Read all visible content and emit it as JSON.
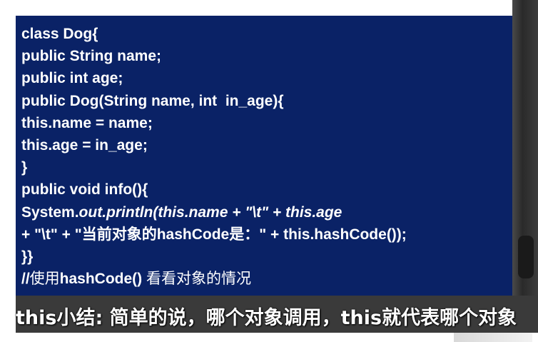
{
  "code": {
    "lines": [
      "class Dog{",
      "public String name;",
      "public int age;",
      "public Dog(String name, int  in_age){",
      "this.name = name;",
      "this.age = in_age;",
      "}",
      "public void info(){"
    ],
    "println": {
      "prefix": "System.",
      "out": "out",
      "dot": ".",
      "method": "println(",
      "this_name": "this.name",
      "plus_tab": " + \"\\t\" + ",
      "this_age": "this.age"
    },
    "concat_line": "+ \"\\t\" + \"当前对象的hashCode是：\" + this.hashCode());",
    "closing": "}}",
    "comment": {
      "slashes": "//",
      "text_before": "使用",
      "code_part": "hashCode()",
      "text_after": " 看看对象的情况"
    }
  },
  "subtitle": {
    "text": "this小结: 简单的说，哪个对象调用，this就代表哪个对象"
  }
}
